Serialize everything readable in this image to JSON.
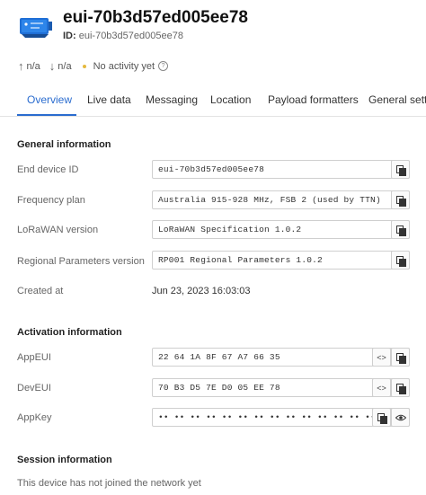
{
  "header": {
    "title": "eui-70b3d57ed005ee78",
    "id_label": "ID:",
    "id_value": "eui-70b3d57ed005ee78"
  },
  "stats": {
    "uplink": "n/a",
    "downlink": "n/a",
    "activity": "No activity yet",
    "help_glyph": "?"
  },
  "tabs": [
    {
      "label": "Overview",
      "active": true
    },
    {
      "label": "Live data"
    },
    {
      "label": "Messaging"
    },
    {
      "label": "Location"
    },
    {
      "label": "Payload formatters"
    },
    {
      "label": "General settin"
    }
  ],
  "general": {
    "heading": "General information",
    "end_device_id_label": "End device ID",
    "end_device_id": "eui-70b3d57ed005ee78",
    "frequency_plan_label": "Frequency plan",
    "frequency_plan": "Australia 915-928 MHz, FSB 2 (used by TTN)",
    "lorawan_version_label": "LoRaWAN version",
    "lorawan_version": "LoRaWAN Specification 1.0.2",
    "regional_label": "Regional Parameters version",
    "regional": "RP001 Regional Parameters 1.0.2",
    "created_label": "Created at",
    "created": "Jun 23, 2023 16:03:03"
  },
  "activation": {
    "heading": "Activation information",
    "appeui_label": "AppEUI",
    "appeui": "22 64 1A 8F 67 A7 66 35",
    "deveui_label": "DevEUI",
    "deveui": "70 B3 D5 7E D0 05 EE 78",
    "appkey_label": "AppKey",
    "appkey": "•• •• •• •• •• •• •• •• •• •• •• •• •• •• •• ••",
    "toggle_glyph": "<>"
  },
  "session": {
    "heading": "Session information",
    "status": "This device has not joined the network yet"
  },
  "colors": {
    "accent": "#2a6ccf",
    "dot": "#e5b93f"
  }
}
